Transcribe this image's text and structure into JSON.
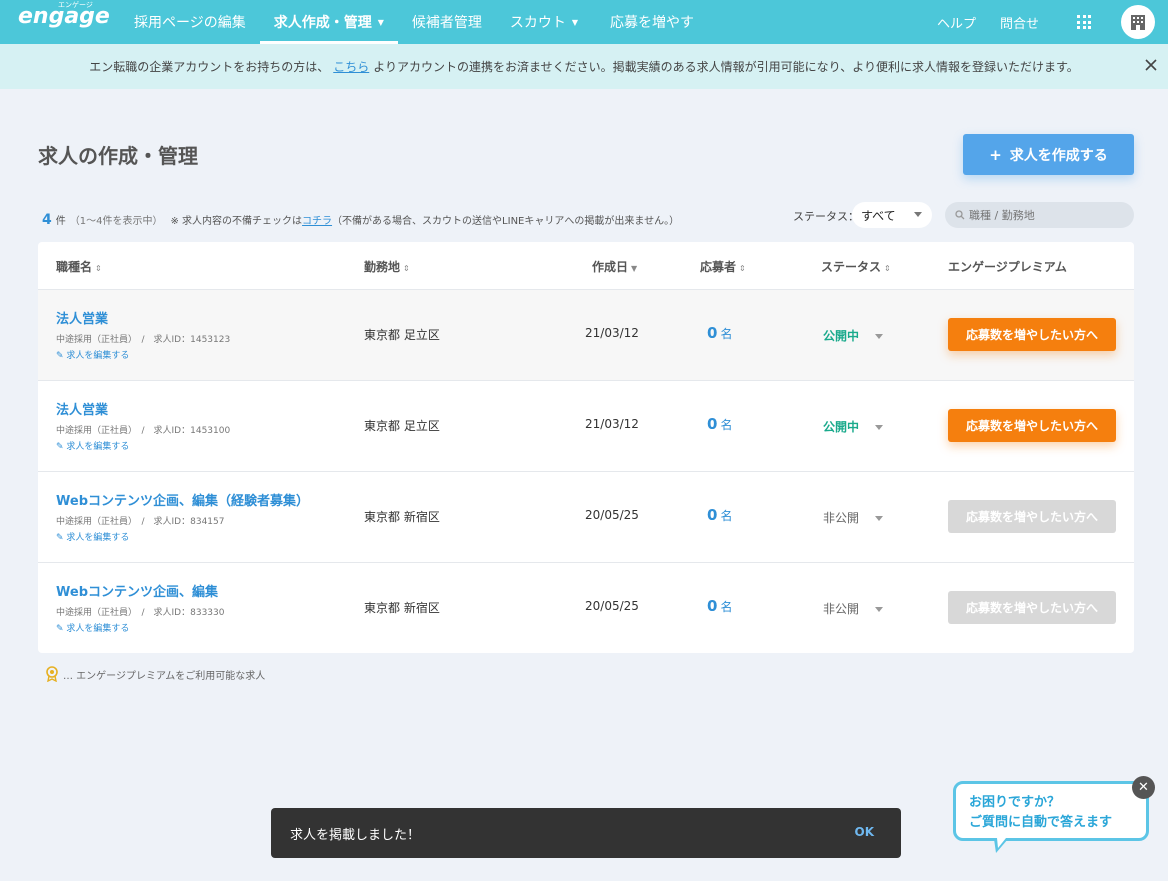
{
  "header": {
    "logo_kana": "エンゲージ",
    "logo_word": "engage",
    "nav": [
      {
        "label": "採用ページの編集"
      },
      {
        "label": "求人作成・管理"
      },
      {
        "label": "候補者管理"
      },
      {
        "label": "スカウト"
      },
      {
        "label": "応募を増やす"
      }
    ],
    "help_label": "ヘルプ",
    "contact_label": "問合せ",
    "icons": {
      "apps": "grid-icon",
      "company": "building-icon"
    }
  },
  "notice": {
    "text_before": "エン転職の企業アカウントをお持ちの方は、",
    "link": "こちら",
    "text_after": "よりアカウントの連携をお済ませください。掲載実績のある求人情報が引用可能になり、より便利に求人情報を登録いただけます。"
  },
  "page": {
    "title": "求人の作成・管理",
    "create_button": "求人を作成する",
    "count": "4",
    "count_unit": "件",
    "count_range": "（1〜4件を表示中）",
    "check_note_before": "※ 求人内容の不備チェックは",
    "check_link": "コチラ",
    "check_note_after": "（不備がある場合、スカウトの送信やLINEキャリアへの掲載が出来ません。）",
    "status_label": "ステータス：",
    "status_value": "すべて",
    "search_placeholder": "職種 / 勤務地"
  },
  "table": {
    "headers": {
      "job": "職種名",
      "location": "勤務地",
      "created": "作成日",
      "applicants": "応募者",
      "status": "ステータス",
      "premium": "エンゲージプレミアム"
    },
    "edit_label": "求人を編集する",
    "applicant_unit": "名",
    "rows": [
      {
        "title": "法人営業",
        "meta": "中途採用（正社員）　/　求人ID：1453123",
        "location": "東京都 足立区",
        "date": "21/03/12",
        "applicants": "0",
        "status": "公開中",
        "premium": "応募数を増やしたい方へ"
      },
      {
        "title": "法人営業",
        "meta": "中途採用（正社員）　/　求人ID：1453100",
        "location": "東京都 足立区",
        "date": "21/03/12",
        "applicants": "0",
        "status": "公開中",
        "premium": "応募数を増やしたい方へ"
      },
      {
        "title": "Webコンテンツ企画、編集（経験者募集）",
        "meta": "中途採用（正社員）　/　求人ID：834157",
        "location": "東京都 新宿区",
        "date": "20/05/25",
        "applicants": "0",
        "status": "非公開",
        "premium": "応募数を増やしたい方へ"
      },
      {
        "title": "Webコンテンツ企画、編集",
        "meta": "中途採用（正社員）　/　求人ID：833330",
        "location": "東京都 新宿区",
        "date": "20/05/25",
        "applicants": "0",
        "status": "非公開",
        "premium": "応募数を増やしたい方へ"
      }
    ]
  },
  "legend": "… エンゲージプレミアムをご利用可能な求人",
  "toast": {
    "message": "求人を掲載しました！",
    "ok": "OK"
  },
  "help_bubble": {
    "line1": "お困りですか？",
    "line2": "ご質問に自動で答えます"
  },
  "colors": {
    "header": "#4cc7d9",
    "accent": "#2f8fd6",
    "published": "#1aaa8c",
    "premium": "#f57f0e",
    "create": "#54a5ea"
  }
}
